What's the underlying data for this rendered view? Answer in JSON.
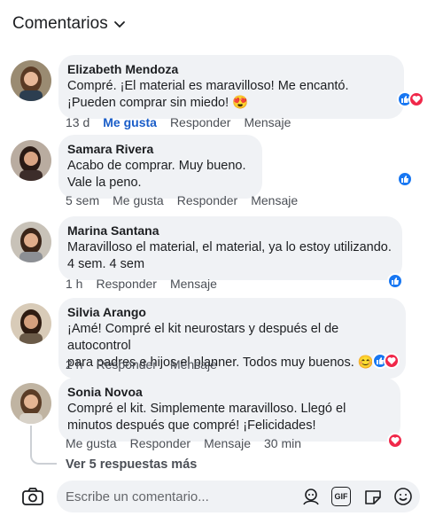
{
  "header": {
    "title": "Comentarios",
    "icon": "chevron-down-icon"
  },
  "comments": [
    {
      "author": "Elizabeth Mendoza",
      "lines": [
        "Compré. ¡El material es maravilloso! Me encantó.",
        "¡Pueden comprar sin miedo! 😍"
      ],
      "time": "13 d",
      "actions": [
        "Me gusta",
        "Responder",
        "Mensaje"
      ],
      "reactions": [
        "like-icon",
        "love-icon"
      ]
    },
    {
      "author": "Samara Rivera",
      "lines": [
        "Acabo de comprar. Muy bueno.",
        "Vale la peno."
      ],
      "time": "5 sem",
      "actions": [
        "Me gusta",
        "Responder",
        "Mensaje"
      ],
      "reactions": [
        "like-icon"
      ]
    },
    {
      "author": "Marina Santana",
      "lines": [
        "Maravilloso el material, el material, ya lo estoy utilizando.",
        "4 sem. 4 sem"
      ],
      "time": "1 h",
      "actions": [
        "Responder",
        "Mensaje"
      ],
      "reactions": [
        "like-icon"
      ]
    },
    {
      "author": "Silvia Arango",
      "lines": [
        "¡Amé! Compré el kit neurostars y después el de autocontrol",
        "para padres e hijos el planner. Todos muy buenos. 😊"
      ],
      "time": "2 h",
      "actions": [
        "Responder",
        "Mensaje"
      ],
      "reactions": [
        "like-icon",
        "love-icon"
      ]
    },
    {
      "author": "Sonia Novoa",
      "lines": [
        "Compré el kit. Simplemente maravilloso. Llegó el",
        "minutos después que compré! ¡Felicidades!"
      ],
      "time": "30 min",
      "actions": [
        "Me gusta",
        "Responder",
        "Mensaje"
      ],
      "reactions": [
        "love-icon"
      ]
    }
  ],
  "replies": {
    "label": "Ver 5 respuestas más"
  },
  "composer": {
    "placeholder": "Escribe un comentario...",
    "icons": [
      "camera-icon",
      "avatar-sticker-icon",
      "gif-icon",
      "sticker-icon",
      "emoji-icon"
    ],
    "gif_label": "GIF"
  },
  "colors": {
    "like": "#1877f2",
    "love": "#f0284a",
    "bubble": "#f0f2f5",
    "link": "#1a5dc8"
  }
}
